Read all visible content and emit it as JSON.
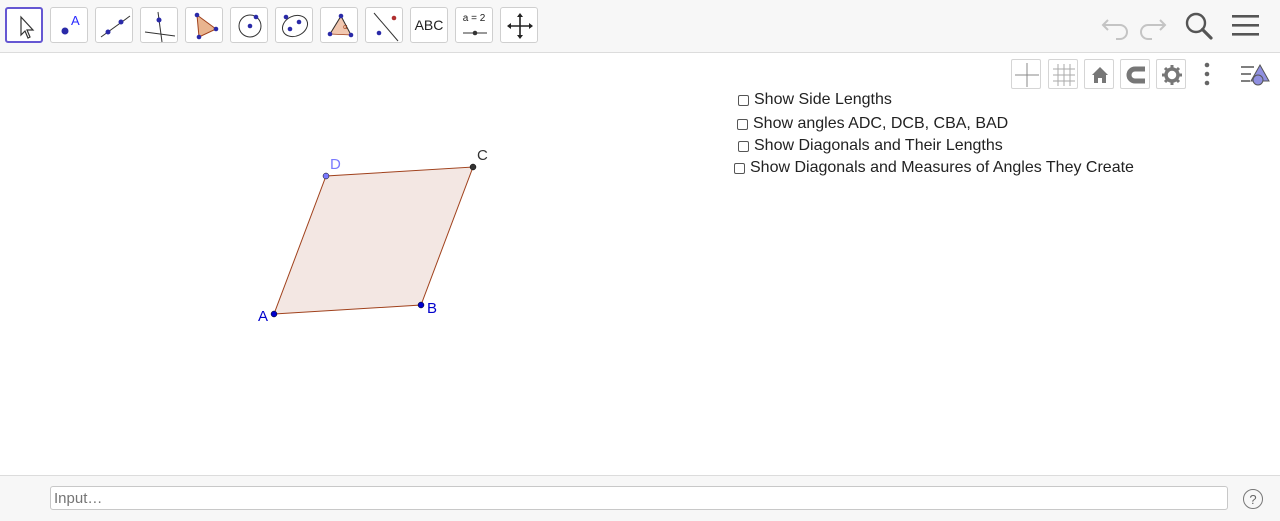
{
  "toolbar": {
    "tools": [
      {
        "name": "move"
      },
      {
        "name": "point",
        "label": "A"
      },
      {
        "name": "line"
      },
      {
        "name": "perpendicular-line"
      },
      {
        "name": "polygon"
      },
      {
        "name": "circle-center-point"
      },
      {
        "name": "ellipse"
      },
      {
        "name": "angle"
      },
      {
        "name": "reflect-about-line"
      },
      {
        "name": "text",
        "label": "ABC"
      },
      {
        "name": "slider",
        "label": "a = 2"
      },
      {
        "name": "move-graphics-view"
      }
    ],
    "actions": [
      "undo-icon",
      "redo-icon",
      "search-icon",
      "menu-icon"
    ]
  },
  "style_bar": [
    "axes-icon",
    "grid-icon",
    "home-icon",
    "magnet-icon",
    "gear-icon",
    "more-icon",
    "algebra-toggle-icon"
  ],
  "checkboxes": [
    {
      "label": "Show Side Lengths",
      "checked": false
    },
    {
      "label": "Show angles ADC, DCB, CBA, BAD",
      "checked": false
    },
    {
      "label": "Show Diagonals and Their Lengths",
      "checked": false
    },
    {
      "label": "Show Diagonals and Measures of Angles They Create",
      "checked": false
    }
  ],
  "points": {
    "A": {
      "label": "A",
      "color": "#0000cc"
    },
    "B": {
      "label": "B",
      "color": "#0000cc"
    },
    "C": {
      "label": "C",
      "color": "#333333"
    },
    "D": {
      "label": "D",
      "color": "#7a7aff"
    }
  },
  "polygon": {
    "fill": "#f3e7e3",
    "stroke": "#a0411c"
  },
  "input": {
    "placeholder": "Input…"
  },
  "help": {
    "label": "?"
  }
}
